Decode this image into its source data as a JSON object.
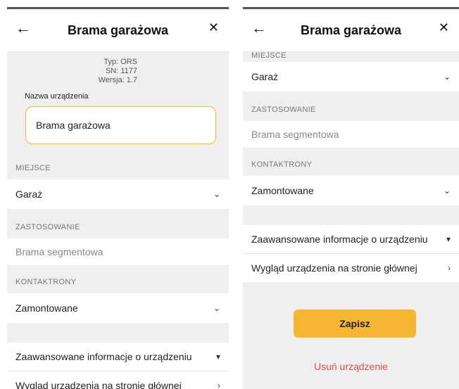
{
  "left": {
    "header": {
      "back_icon": "arrow-left-icon",
      "title": "Brama garażowa",
      "close_icon": "close-icon"
    },
    "device_info": {
      "type": "Typ: ORS",
      "sn": "SN: 1177",
      "version": "Wersja: 1.7"
    },
    "name_label": "Nazwa urządzenia",
    "name_value": "Brama garażowa",
    "place": {
      "label": "MIEJSCE",
      "value": "Garaż"
    },
    "usage": {
      "label": "ZASTOSOWANIE",
      "value": "Brama segmentowa"
    },
    "contacts": {
      "label": "KONTAKTRONY",
      "value": "Zamontowane"
    },
    "advanced": "Zaawansowane informacje o urządzeniu",
    "appearance": "Wygląd urządzenia na stronie głównej"
  },
  "right": {
    "header": {
      "back_icon": "arrow-left-icon",
      "title": "Brama garażowa",
      "close_icon": "close-icon"
    },
    "place": {
      "label": "MIEJSCE",
      "value": "Garaż"
    },
    "usage": {
      "label": "ZASTOSOWANIE",
      "value": "Brama segmentowa"
    },
    "contacts": {
      "label": "KONTAKTRONY",
      "value": "Zamontowane"
    },
    "advanced": "Zaawansowane informacje o urządzeniu",
    "appearance": "Wygląd urządzenia na stronie głównej",
    "save_label": "Zapisz",
    "delete_label": "Usuń urządzenie"
  },
  "colors": {
    "accent": "#f5b731",
    "danger": "#e5484d",
    "background": "#efefef"
  }
}
